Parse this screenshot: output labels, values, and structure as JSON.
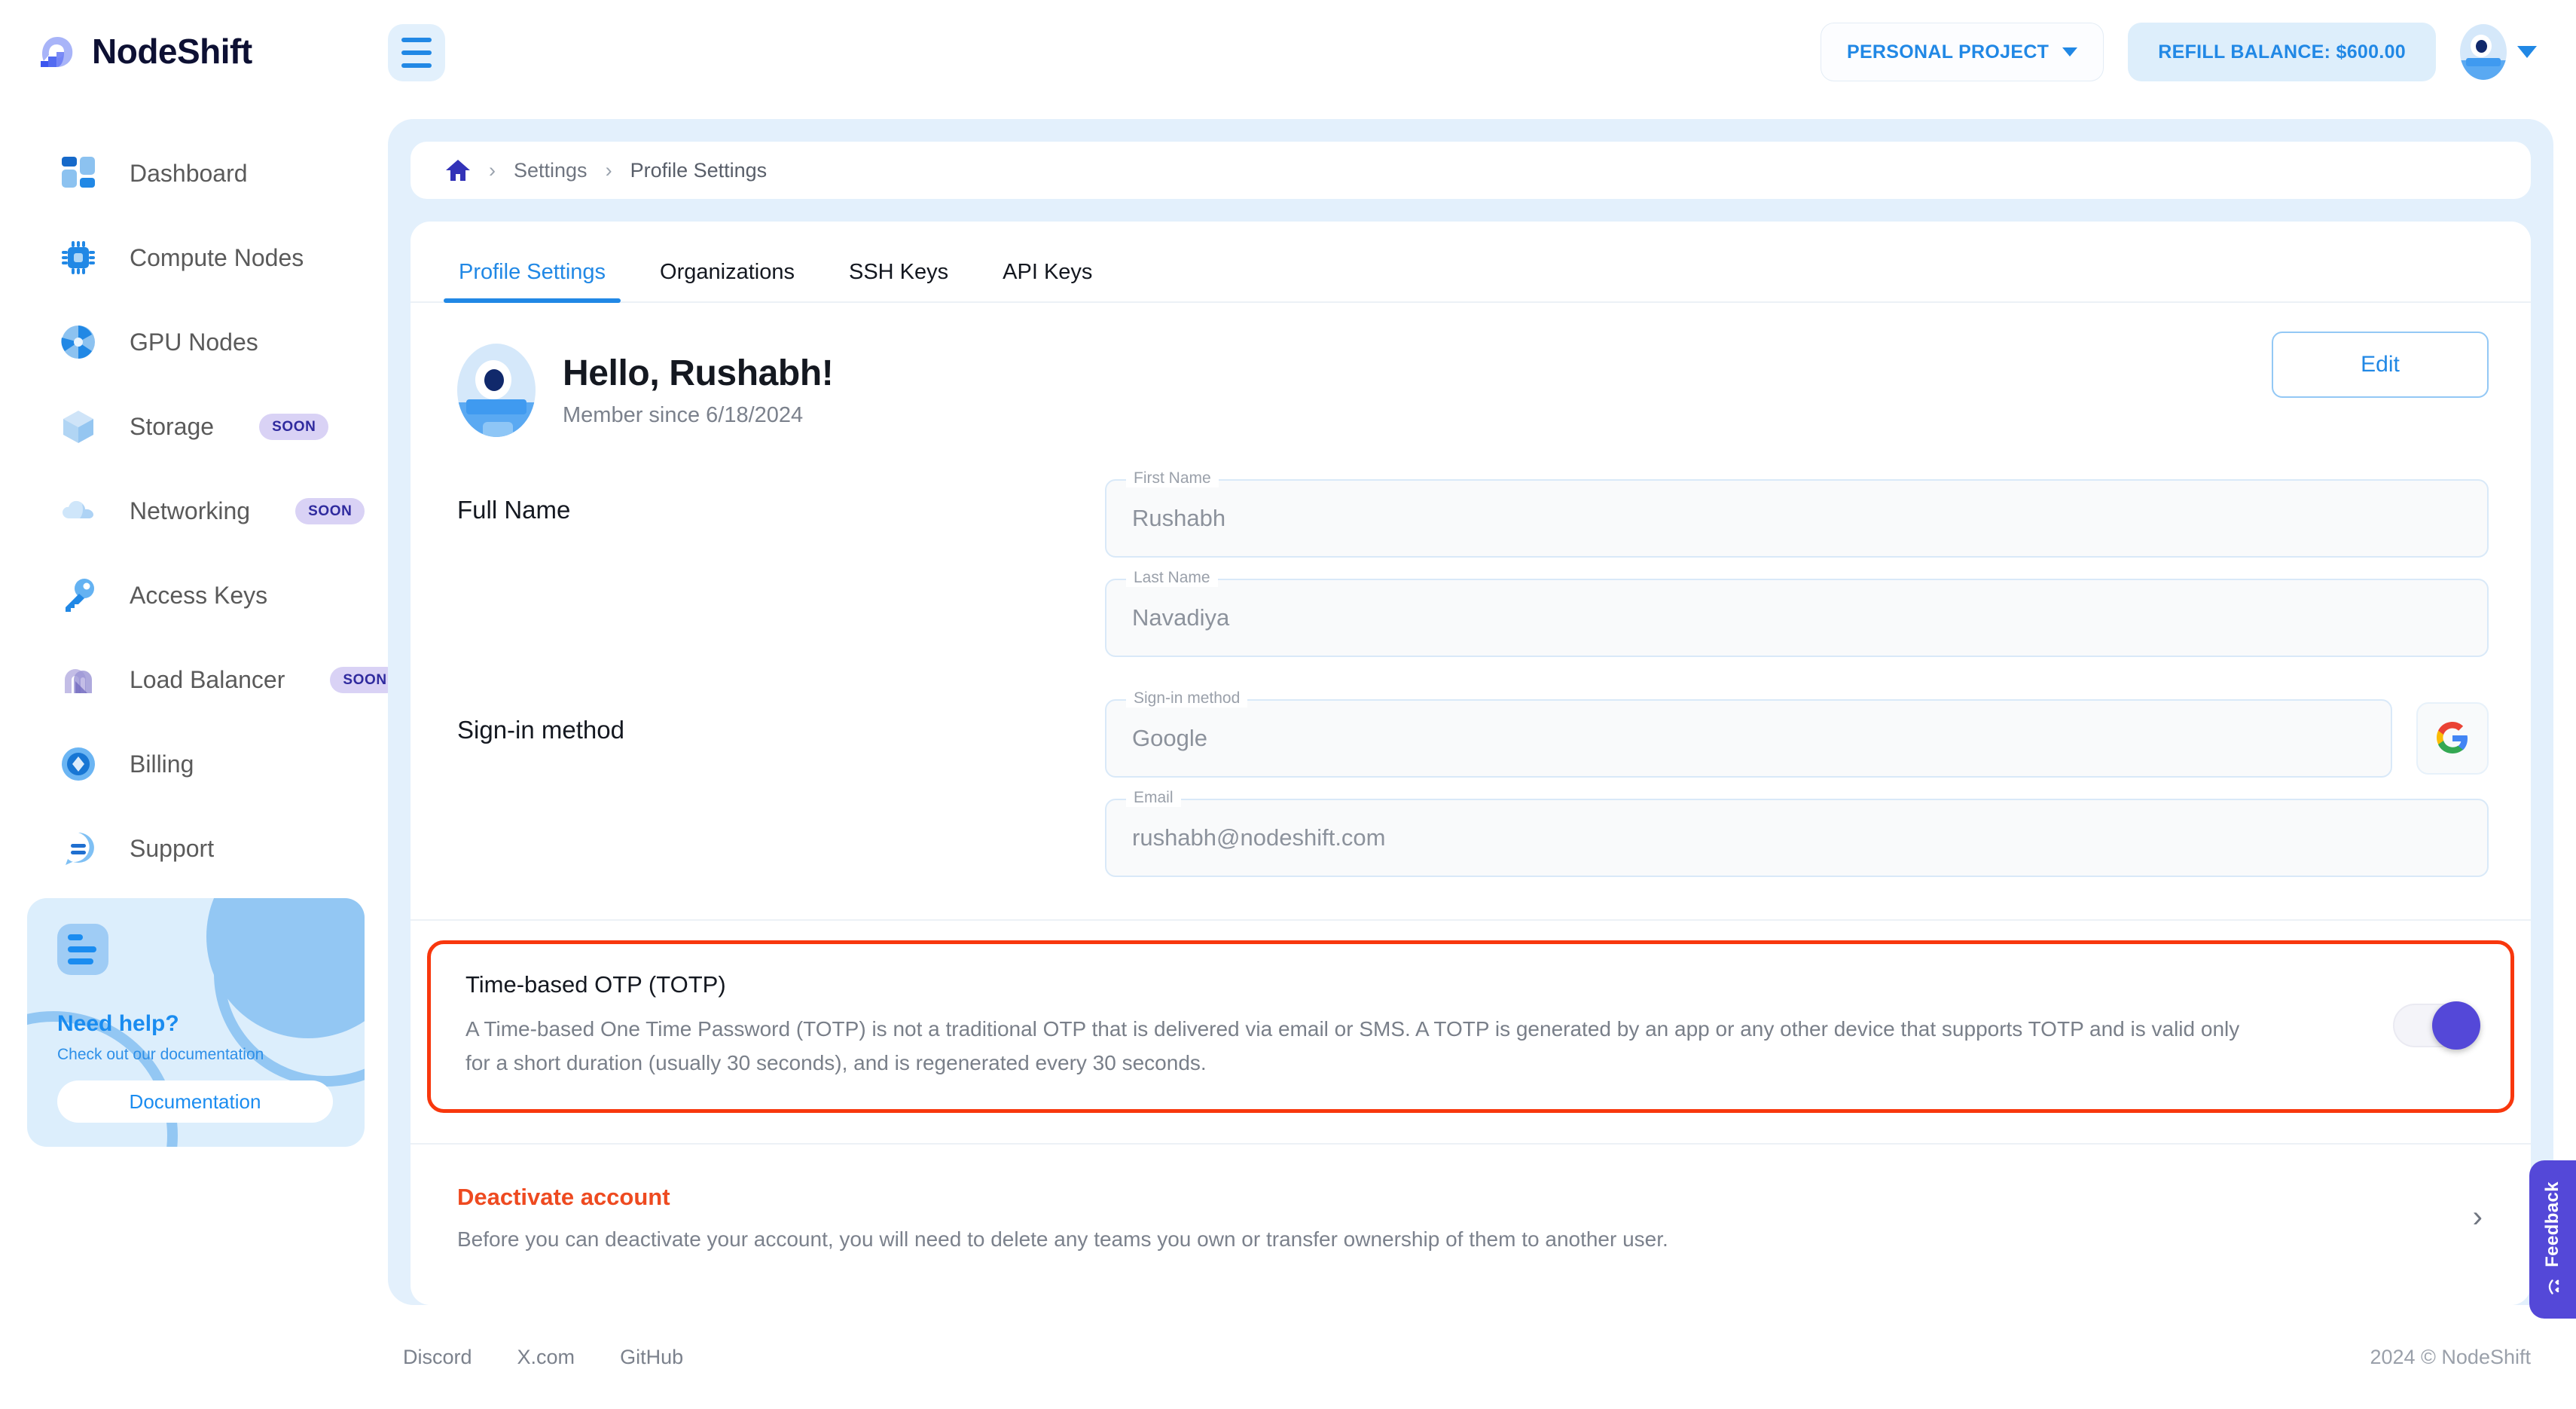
{
  "brand": {
    "name": "NodeShift",
    "logo_icon": "nodeshift-wave-logo"
  },
  "sidebar": {
    "items": [
      {
        "label": "Dashboard",
        "icon": "dashboard-grid-icon",
        "badge": ""
      },
      {
        "label": "Compute Nodes",
        "icon": "cpu-chip-icon",
        "badge": ""
      },
      {
        "label": "GPU Nodes",
        "icon": "gpu-fan-icon",
        "badge": ""
      },
      {
        "label": "Storage",
        "icon": "cube-box-icon",
        "badge": "SOON"
      },
      {
        "label": "Networking",
        "icon": "cloud-icon",
        "badge": "SOON"
      },
      {
        "label": "Access Keys",
        "icon": "key-icon",
        "badge": ""
      },
      {
        "label": "Load Balancer",
        "icon": "load-balancer-icon",
        "badge": "SOON"
      },
      {
        "label": "Billing",
        "icon": "billing-diamond-icon",
        "badge": ""
      },
      {
        "label": "Support",
        "icon": "chat-bubble-icon",
        "badge": ""
      }
    ],
    "help_card": {
      "icon": "document-lines-icon",
      "title": "Need help?",
      "subtitle": "Check out our documentation",
      "button_label": "Documentation"
    }
  },
  "topbar": {
    "menu_icon": "hamburger-menu-icon",
    "project_label": "PERSONAL PROJECT",
    "project_chevron_icon": "chevron-down-icon",
    "refill_label": "REFILL BALANCE:",
    "refill_amount": "$600.00",
    "refill_full": "REFILL BALANCE:  $600.00",
    "avatar_icon": "user-avatar-alien",
    "avatar_chevron_icon": "chevron-down-icon"
  },
  "breadcrumb": {
    "home_icon": "home-icon",
    "separator": "›",
    "items": [
      "Settings",
      "Profile Settings"
    ]
  },
  "tabs": [
    {
      "label": "Profile Settings",
      "active": true
    },
    {
      "label": "Organizations",
      "active": false
    },
    {
      "label": "SSH Keys",
      "active": false
    },
    {
      "label": "API Keys",
      "active": false
    }
  ],
  "profile": {
    "avatar_icon": "user-avatar-alien",
    "greeting": "Hello, Rushabh!",
    "member_since": "Member since 6/18/2024",
    "edit_label": "Edit"
  },
  "full_name": {
    "section_label": "Full Name",
    "first_name": {
      "label": "First Name",
      "value": "Rushabh"
    },
    "last_name": {
      "label": "Last Name",
      "value": "Navadiya"
    }
  },
  "signin": {
    "section_label": "Sign-in method",
    "method": {
      "label": "Sign-in method",
      "value": "Google"
    },
    "email": {
      "label": "Email",
      "value": "rushabh@nodeshift.com"
    },
    "provider_icon": "google-icon"
  },
  "totp": {
    "title": "Time-based OTP (TOTP)",
    "description": "A Time-based One Time Password (TOTP) is not a traditional OTP that is delivered via email or SMS. A TOTP is generated by an app or any other device that supports TOTP and is valid only for a short duration (usually 30 seconds), and is regenerated every 30 seconds.",
    "toggle_state": "on",
    "highlight_color": "#f8370d",
    "toggle_color": "#5448d8"
  },
  "deactivate": {
    "title": "Deactivate account",
    "description": "Before you can deactivate your account, you will need to delete any teams you own or transfer ownership of them to another user.",
    "chevron_icon": "chevron-right-icon",
    "title_color": "#ee4a20"
  },
  "footer": {
    "links": [
      "Discord",
      "X.com",
      "GitHub"
    ],
    "copyright": "2024 © NodeShift"
  },
  "feedback": {
    "label": "Feedback",
    "icon": "smiley-heart-eyes-icon"
  },
  "colors": {
    "accent_blue": "#2188e5",
    "panel_bg": "#e3f0fc",
    "brand_navy": "#0d1033",
    "soon_badge_bg": "#d9d2f5",
    "soon_badge_text": "#2f2a9e"
  }
}
